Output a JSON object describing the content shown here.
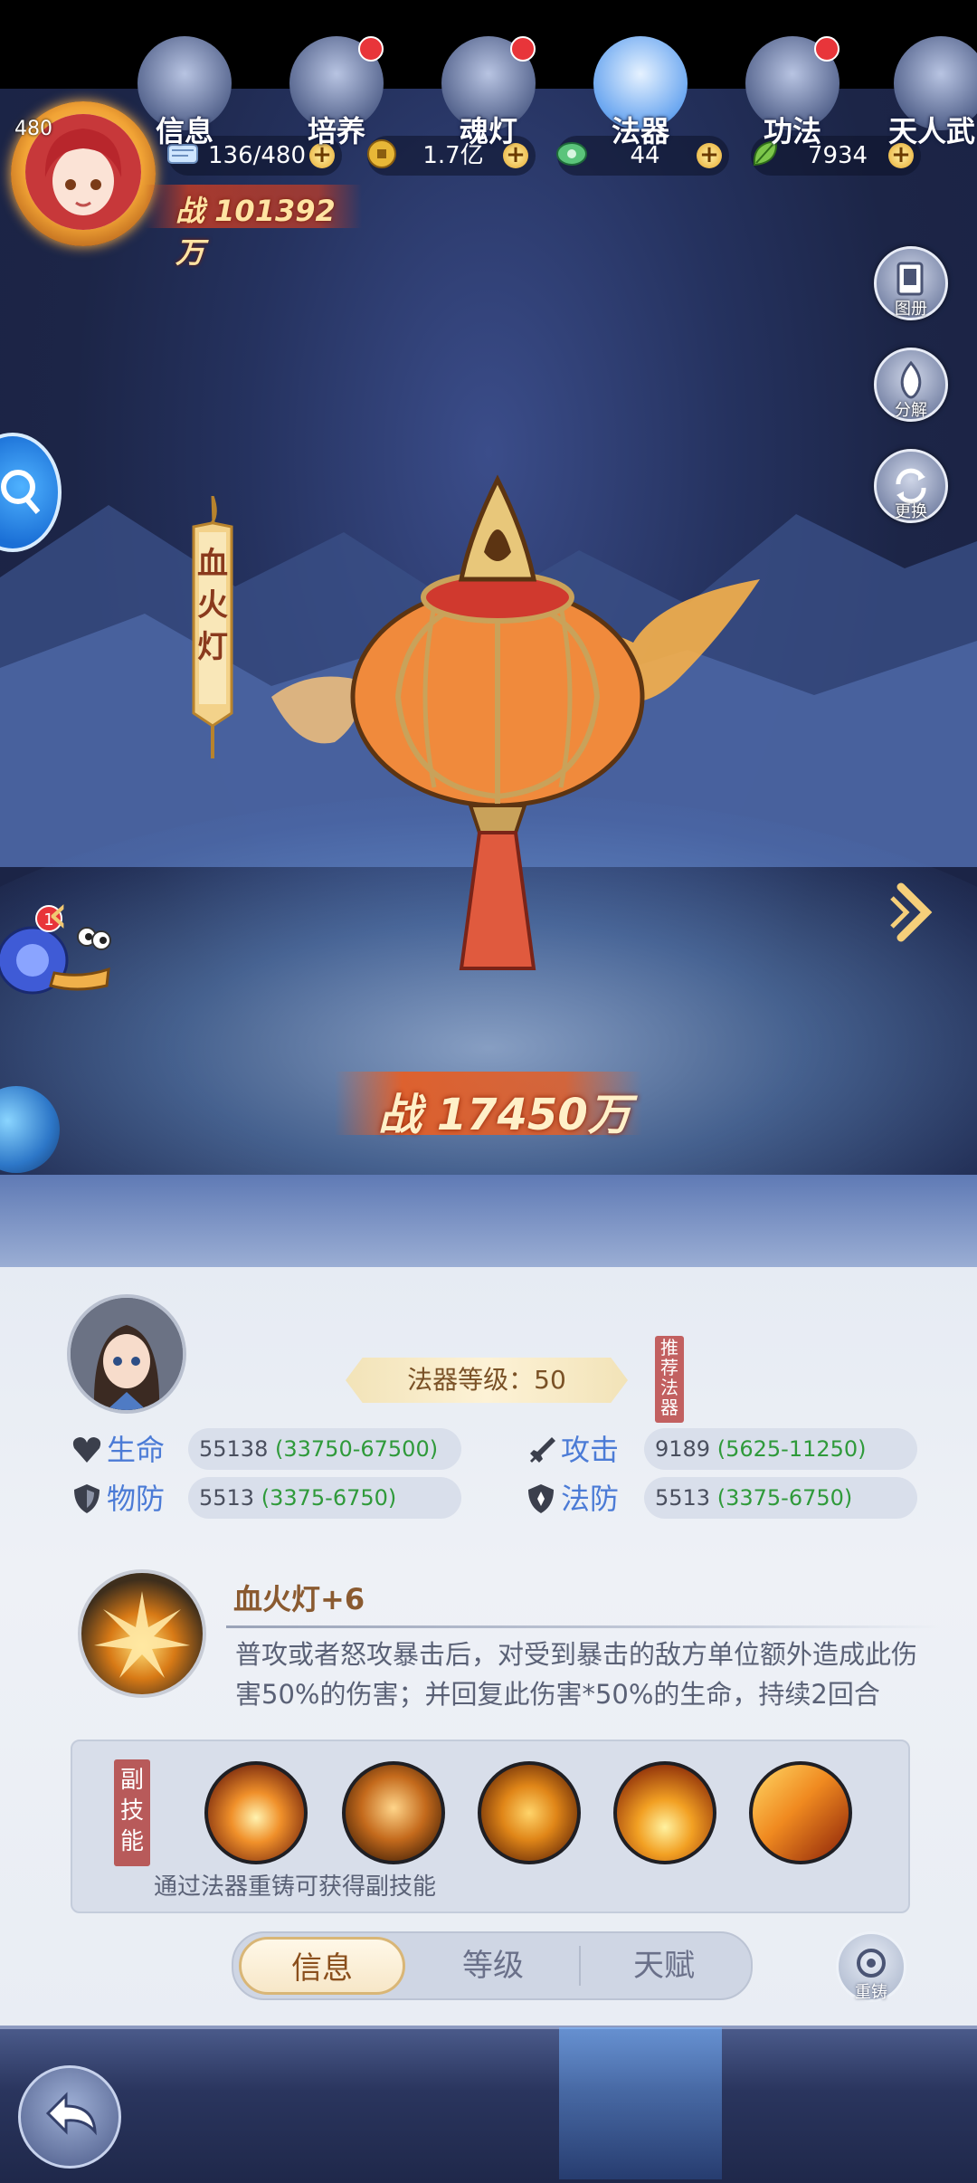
{
  "player": {
    "level": "480",
    "power": "101392万"
  },
  "resources": [
    {
      "name": "stamina",
      "value": "136/480",
      "icon": "scroll-icon"
    },
    {
      "name": "coins",
      "value": "1.7亿",
      "icon": "coin-icon"
    },
    {
      "name": "jade",
      "value": "44",
      "icon": "jade-icon"
    },
    {
      "name": "leaf",
      "value": "7934",
      "icon": "leaf-icon"
    }
  ],
  "right_buttons": [
    {
      "label": "图册"
    },
    {
      "label": "分解"
    },
    {
      "label": "更换"
    }
  ],
  "artifact": {
    "name": "血火灯",
    "power_prefix": "战",
    "power": "17450万",
    "level_label": "法器等级：50",
    "recommend": "推荐法器"
  },
  "stats": [
    {
      "label": "生命",
      "value": "55138",
      "range": "(33750-67500)"
    },
    {
      "label": "攻击",
      "value": "9189",
      "range": "(5625-11250)"
    },
    {
      "label": "物防",
      "value": "5513",
      "range": "(3375-6750)"
    },
    {
      "label": "法防",
      "value": "5513",
      "range": "(3375-6750)"
    }
  ],
  "skill": {
    "name": "血火灯+6",
    "description": "普攻或者怒攻暴击后，对受到暴击的敌方单位额外造成此伤害50%的伤害；并回复此伤害*50%的生命，持续2回合"
  },
  "sub_skills": {
    "tag": "副技能",
    "note": "通过法器重铸可获得副技能",
    "count": 5
  },
  "tabs": [
    "信息",
    "等级",
    "天赋"
  ],
  "recast_label": "重铸",
  "snail_badge": "1",
  "bottom_nav": [
    {
      "label": "信息",
      "dot": false
    },
    {
      "label": "培养",
      "dot": true
    },
    {
      "label": "魂灯",
      "dot": true
    },
    {
      "label": "法器",
      "dot": false,
      "active": true
    },
    {
      "label": "功法",
      "dot": true
    },
    {
      "label": "天人武",
      "dot": false
    }
  ]
}
